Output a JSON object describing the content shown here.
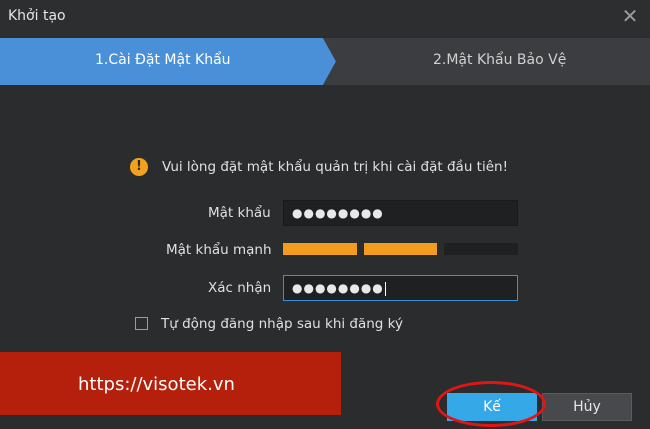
{
  "window": {
    "title": "Khởi tạo",
    "close_glyph": "✕"
  },
  "steps": [
    {
      "label": "1.Cài Đặt Mật Khẩu",
      "state": "active",
      "color": "#4a90d9"
    },
    {
      "label": "2.Mật Khẩu Bảo Vệ",
      "state": "inactive",
      "color": "#3c3d40"
    }
  ],
  "form": {
    "warning_icon": "warning-icon",
    "warning_glyph": "!",
    "warning_text": "Vui lòng đặt mật khẩu quản trị khi cài đặt đầu tiên!",
    "password_label": "Mật khẩu",
    "password_value": "●●●●●●●●",
    "strength_label": "Mật khẩu mạnh",
    "strength_level": "2 of 3",
    "strength_colors": [
      "#f39c1f",
      "#f39c1f",
      "#1f2022"
    ],
    "confirm_label": "Xác nhận",
    "confirm_value": "●●●●●●●●",
    "auto_login_label": "Tự động đăng nhập sau khi đăng ký",
    "auto_login_checked": false
  },
  "banner": {
    "text": "https://visotek.vn",
    "color": "#b5200d"
  },
  "buttons": {
    "next_label": "Kế",
    "cancel_label": "Hủy"
  },
  "colors": {
    "accent": "#35a8e8",
    "background": "#2b2c2e",
    "highlight": "#e21515"
  }
}
